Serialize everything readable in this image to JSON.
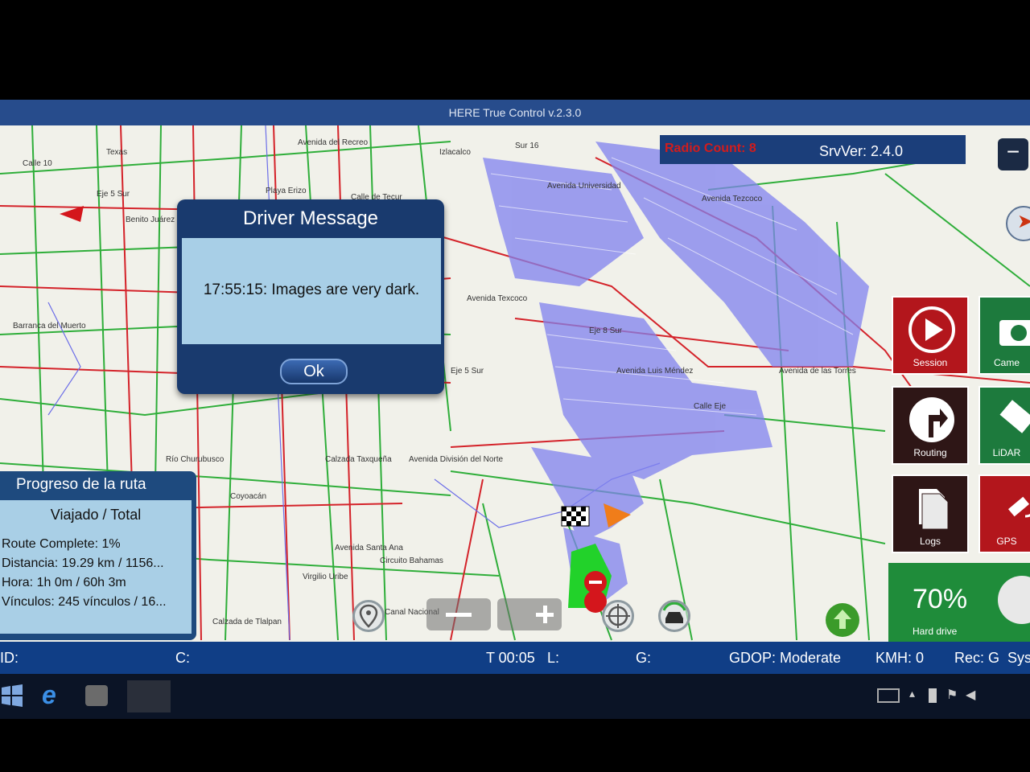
{
  "window": {
    "title": "HERE True Control v.2.3.0"
  },
  "top_info": {
    "radio_count": "Radio Count: 8",
    "server_version": "SrvVer: 2.4.0"
  },
  "map": {
    "streets": [
      "Calle 10",
      "Texas",
      "Eje 5 Sur",
      "Benito Juárez",
      "Playa Erizo",
      "Calle de Tecur",
      "Avenida del Recreo",
      "Sur 16",
      "Izlacalco",
      "Avenida Universidad",
      "Avenida Texcoco",
      "Avenida Tezcoco",
      "Eje 8 Sur",
      "Avenida Luis Méndez",
      "Avenida de las Torres",
      "Avenida División del Norte",
      "Calzada Taxqueña",
      "Avenida Santa Ana",
      "Circuito Bahamas",
      "Virgilio Uribe",
      "Calzada de Tlalpan",
      "Barranca del Muerto",
      "Río Churubusco",
      "Coyoacán",
      "Canal Nacional",
      "Calle Eje",
      "Eje 5 Sur"
    ]
  },
  "dialog": {
    "title": "Driver Message",
    "message": "17:55:15: Images are very dark.",
    "ok_label": "Ok"
  },
  "progress": {
    "title": "Progreso de la ruta",
    "subtitle": "Viajado / Total",
    "route_complete": "Route Complete: 1%",
    "distance": "Distancia: 19.29 km / 1156...",
    "time": "Hora: 1h 0m / 60h 3m",
    "links": "Vínculos: 245 vínculos / 16..."
  },
  "tiles": {
    "session": "Session",
    "camera": "Came",
    "routing": "Routing",
    "lidar": "LiDAR",
    "logs": "Logs",
    "gps": "GPS",
    "hard_drive_value": "70%",
    "hard_drive_label": "Hard drive"
  },
  "status_bar": {
    "id": "ID:",
    "c": "C:",
    "time": "T 00:05",
    "l": "L:",
    "g": "G:",
    "gdop": "GDOP: Moderate",
    "kmh": "KMH: 0",
    "rec": "Rec: G",
    "sys": "Sys"
  },
  "colors": {
    "title_blue": "#274c8c",
    "dialog_blue": "#193a6e",
    "dialog_panel": "#a8cfe7",
    "session_red": "#b3161c",
    "routing_dark": "#2e1616",
    "camera_green": "#1d7a3d",
    "hard_drive_green": "#1f8c3a"
  }
}
